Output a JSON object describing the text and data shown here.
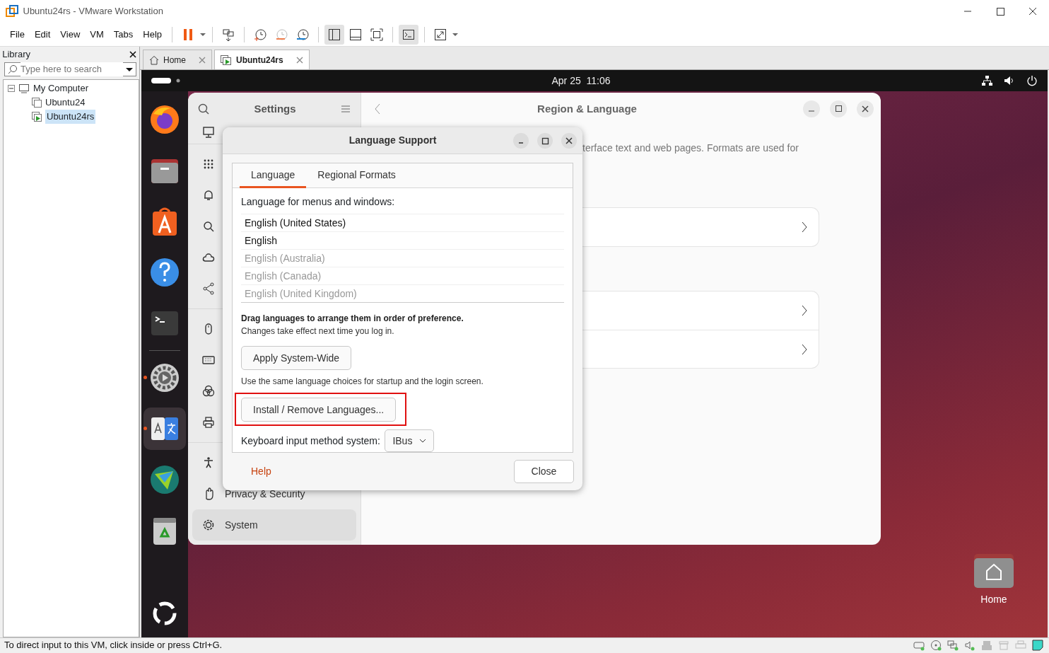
{
  "window": {
    "title": "Ubuntu24rs - VMware Workstation"
  },
  "menu": [
    "File",
    "Edit",
    "View",
    "VM",
    "Tabs",
    "Help"
  ],
  "library": {
    "title": "Library",
    "search": {
      "placeholder": "Type here to search"
    },
    "tree": [
      {
        "label": "My Computer",
        "expanded": true,
        "children": [
          {
            "label": "Ubuntu24",
            "running": false,
            "selected": false
          },
          {
            "label": "Ubuntu24rs",
            "running": true,
            "selected": true
          }
        ]
      }
    ]
  },
  "tabs": [
    {
      "label": "Home",
      "selected": false
    },
    {
      "label": "Ubuntu24rs",
      "selected": true
    }
  ],
  "topbar": {
    "clock": "Apr 25  11:06"
  },
  "dock": [
    {
      "kind": "browser",
      "running": false,
      "selected": false
    },
    {
      "kind": "files",
      "running": false,
      "selected": false
    },
    {
      "kind": "store",
      "running": false,
      "selected": false
    },
    {
      "kind": "help",
      "running": false,
      "selected": false
    },
    {
      "kind": "terminal",
      "running": false,
      "selected": false
    },
    {
      "kind": "settings",
      "running": true,
      "selected": false
    },
    {
      "kind": "language",
      "running": true,
      "selected": true
    },
    {
      "kind": "app",
      "running": false,
      "selected": false
    },
    {
      "kind": "trash",
      "running": false,
      "selected": false
    }
  ],
  "settings": {
    "title": "Settings",
    "sidebar": [
      {
        "label": "Privacy & Security",
        "selected": false
      },
      {
        "label": "System",
        "selected": true
      }
    ],
    "page_title": "Region & Language",
    "description": "terface text and web pages. Formats are used for"
  },
  "dialog": {
    "title": "Language Support",
    "tabs": [
      {
        "label": "Language",
        "selected": true
      },
      {
        "label": "Regional Formats",
        "selected": false
      }
    ],
    "list_label": "Language for menus and windows:",
    "languages": [
      {
        "label": "English (United States)",
        "disabled": false
      },
      {
        "label": "English",
        "disabled": false
      },
      {
        "label": "English (Australia)",
        "disabled": true
      },
      {
        "label": "English (Canada)",
        "disabled": true
      },
      {
        "label": "English (United Kingdom)",
        "disabled": true
      }
    ],
    "hint_bold": "Drag languages to arrange them in order of preference.",
    "hint": "Changes take effect next time you log in.",
    "apply_button": "Apply System-Wide",
    "apply_note": "Use the same language choices for startup and the login screen.",
    "install_button": {
      "label": "Install / Remove Languages...",
      "highlighted": true
    },
    "input_label": "Keyboard input method system:",
    "input_method": "IBus",
    "help": "Help",
    "close": "Close"
  },
  "desktop_icons": [
    {
      "label": "Home"
    }
  ],
  "status_bar": {
    "text": "To direct input to this VM, click inside or press Ctrl+G."
  }
}
